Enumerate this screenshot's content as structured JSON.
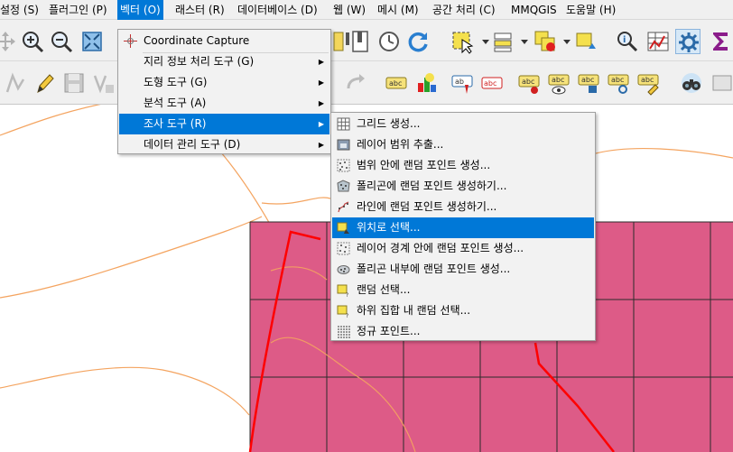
{
  "menubar": {
    "items": [
      {
        "label": "설정 (S)"
      },
      {
        "label": "플러그인 (P)"
      },
      {
        "label": "벡터 (O)"
      },
      {
        "label": "래스터 (R)"
      },
      {
        "label": "데이터베이스 (D)"
      },
      {
        "label": "웹 (W)"
      },
      {
        "label": "메시 (M)"
      },
      {
        "label": "공간 처리 (C)"
      },
      {
        "label": "MMQGIS"
      },
      {
        "label": "도움말 (H)"
      }
    ]
  },
  "vector_menu": {
    "items": [
      {
        "label": "Coordinate Capture",
        "icon": "crosshair-icon"
      },
      {
        "label": "지리 정보 처리 도구 (G)",
        "submenu": true
      },
      {
        "label": "도형 도구 (G)",
        "submenu": true
      },
      {
        "label": "분석 도구 (A)",
        "submenu": true
      },
      {
        "label": "조사 도구 (R)",
        "submenu": true,
        "highlighted": true
      },
      {
        "label": "데이터 관리 도구 (D)",
        "submenu": true
      }
    ]
  },
  "research_submenu": {
    "items": [
      {
        "label": "그리드 생성...",
        "icon": "grid-icon"
      },
      {
        "label": "레이어 범위 추출...",
        "icon": "layer-extent-icon"
      },
      {
        "label": "범위 안에 랜덤 포인트 생성...",
        "icon": "random-points-extent-icon"
      },
      {
        "label": "폴리곤에 랜덤 포인트 생성하기...",
        "icon": "random-points-polygon-icon"
      },
      {
        "label": "라인에 랜덤 포인트 생성하기...",
        "icon": "random-points-line-icon"
      },
      {
        "label": "위치로 선택...",
        "icon": "select-by-location-icon",
        "highlighted": true
      },
      {
        "label": "레이어 경계 안에 랜덤 포인트 생성...",
        "icon": "random-points-bounds-icon"
      },
      {
        "label": "폴리곤 내부에 랜덤 포인트 생성...",
        "icon": "random-points-inside-icon"
      },
      {
        "label": "랜덤 선택...",
        "icon": "random-select-icon"
      },
      {
        "label": "하위 집합 내 랜덤 선택...",
        "icon": "random-subset-icon"
      },
      {
        "label": "정규 포인트...",
        "icon": "regular-points-icon"
      }
    ]
  },
  "toolbar": {
    "label_tool_text": "abc"
  },
  "colors": {
    "menu_highlight": "#0078d7",
    "polygon_fill": "#dd5b87",
    "contour": "#f4a460",
    "boundary": "#ff0000"
  }
}
